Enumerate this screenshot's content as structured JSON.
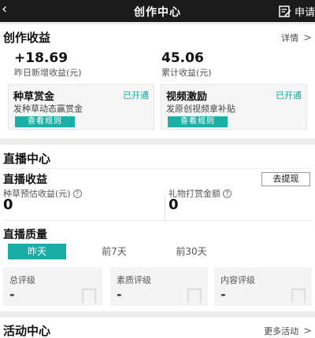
{
  "topbar": {
    "back_icon": "chevron-left-icon",
    "title": "创作中心",
    "apply_icon": "document-edit-icon",
    "apply_label": "申请"
  },
  "creation": {
    "title": "创作收益",
    "details_label": "详情",
    "yesterday_value": "+18.69",
    "yesterday_label": "昨日新增收益(元)",
    "total_value": "45.06",
    "total_label": "累计收益(元)",
    "cards": [
      {
        "title": "种草赏金",
        "status": "已开通",
        "desc": "发种草动态赢赏金",
        "button": "查看规则"
      },
      {
        "title": "视频激励",
        "status": "已开通",
        "desc": "发原创视频拿补贴",
        "button": "查看规则"
      }
    ]
  },
  "live": {
    "title": "直播中心",
    "earnings_title": "直播收益",
    "withdraw_label": "去提现",
    "estimated_label": "种草预估收益(元)",
    "estimated_value": "0",
    "gift_label": "礼物打赏金额",
    "gift_value": "0",
    "quality_title": "直播质量",
    "tabs": [
      {
        "label": "昨天",
        "active": true
      },
      {
        "label": "前7天",
        "active": false
      },
      {
        "label": "前30天",
        "active": false
      }
    ],
    "quality_items": [
      {
        "label": "总评级",
        "value": "-"
      },
      {
        "label": "素质评级",
        "value": "-"
      },
      {
        "label": "内容评级",
        "value": "-"
      }
    ]
  },
  "activity": {
    "title": "活动中心",
    "more_label": "更多活动"
  },
  "colors": {
    "accent": "#1ab0a6",
    "topbar_bg": "#1b1b1b",
    "page_bg": "#ececec"
  }
}
